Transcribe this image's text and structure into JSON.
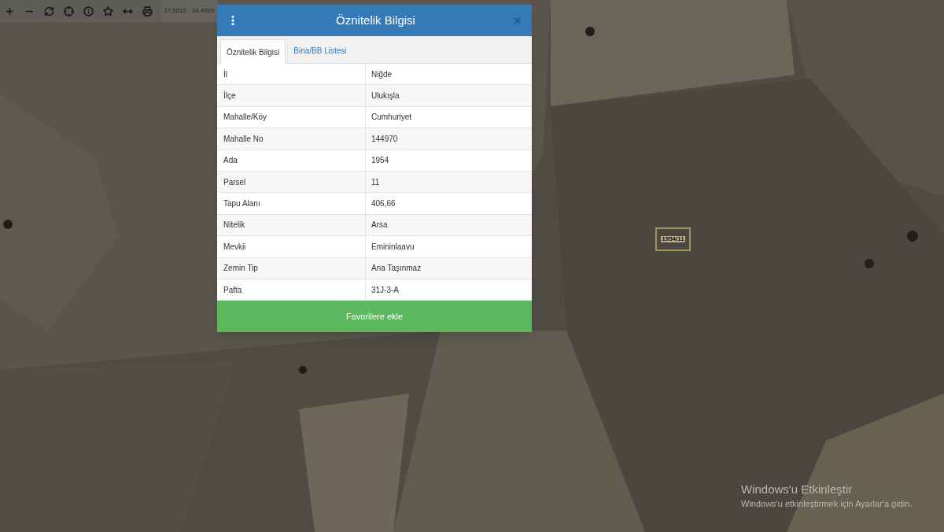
{
  "toolbar": {
    "coordinates": "37.5610 , 34.4093"
  },
  "map": {
    "parcel_label": "1954/11"
  },
  "dialog": {
    "title": "Öznitelik Bilgisi",
    "tabs": [
      {
        "label": "Öznitelik Bilgisi",
        "selected": true
      },
      {
        "label": "Bina/BB Listesi",
        "selected": false
      }
    ],
    "rows": [
      {
        "field": "İl",
        "value": "Niğde"
      },
      {
        "field": "İlçe",
        "value": "Ulukışla"
      },
      {
        "field": "Mahalle/Köy",
        "value": "Cumhuriyet"
      },
      {
        "field": "Mahalle No",
        "value": "144970"
      },
      {
        "field": "Ada",
        "value": "1954"
      },
      {
        "field": "Parsel",
        "value": "11"
      },
      {
        "field": "Tapu Alanı",
        "value": "406,66"
      },
      {
        "field": "Nitelik",
        "value": "Arsa"
      },
      {
        "field": "Mevkii",
        "value": "Emininlaavu"
      },
      {
        "field": "Zemin Tip",
        "value": "Ana Taşınmaz"
      },
      {
        "field": "Pafta",
        "value": "31J-3-A"
      }
    ],
    "action": "Favorilere ekle"
  },
  "activation": {
    "title": "Windows'u Etkinleştir",
    "message": "Windows'u etkinleştirmek için Ayarlar'a gidin."
  }
}
